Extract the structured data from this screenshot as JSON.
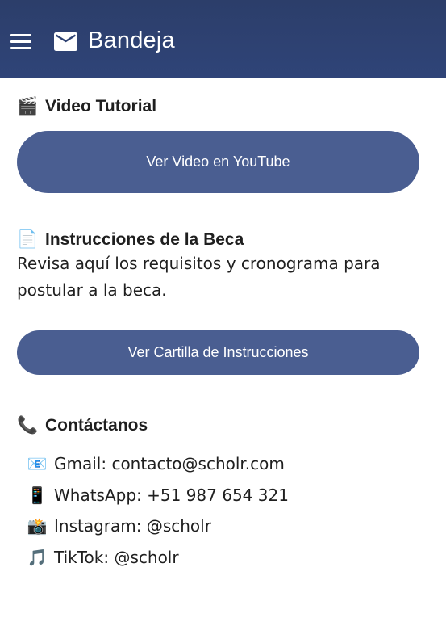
{
  "header": {
    "title": "Bandeja",
    "menu_icon": "hamburger-menu-icon",
    "title_icon": "mail-icon",
    "background": "#2e4272"
  },
  "video_section": {
    "icon": "🎬",
    "title": "Video Tutorial",
    "button_label": "Ver Video en YouTube"
  },
  "instructions_section": {
    "icon": "📄",
    "title": "Instrucciones de la Beca",
    "description": "Revisa aquí los requisitos y cronograma para postular a la beca.",
    "button_label": "Ver Cartilla de Instrucciones"
  },
  "contact_section": {
    "icon": "📞",
    "title": "Contáctanos",
    "items": [
      {
        "icon": "📧",
        "text": "Gmail: contacto@scholr.com"
      },
      {
        "icon": "📱",
        "text": "WhatsApp: +51 987 654 321"
      },
      {
        "icon": "📸",
        "text": "Instagram: @scholr"
      },
      {
        "icon": "🎵",
        "text": "TikTok: @scholr"
      }
    ]
  },
  "colors": {
    "accent_button": "#4a5e91",
    "header_bg": "#2e4272",
    "text": "#1f1f1f"
  }
}
